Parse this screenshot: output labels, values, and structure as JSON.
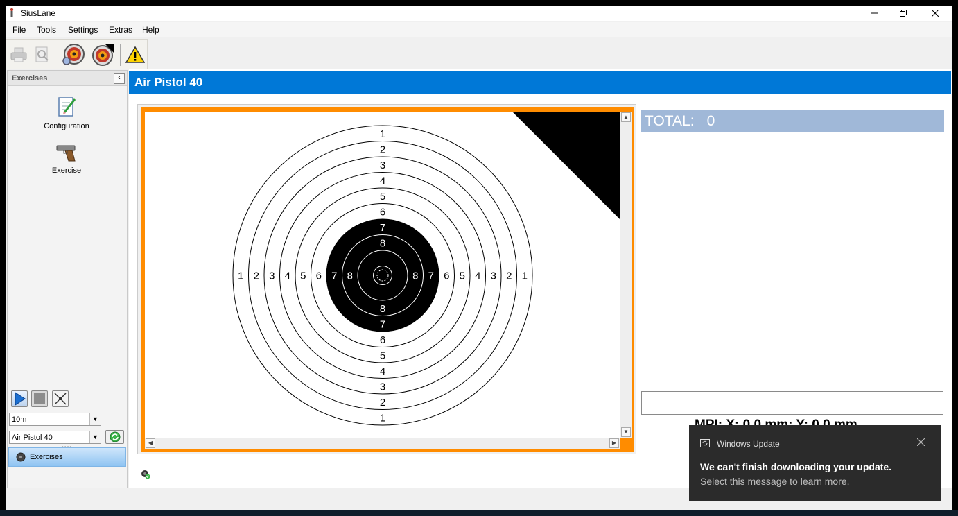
{
  "window": {
    "title": "SiusLane"
  },
  "menu": [
    "File",
    "Tools",
    "Settings",
    "Extras",
    "Help"
  ],
  "toolbar": {
    "buttons": [
      "print-icon",
      "print-preview-icon",
      "target-magnifier-icon",
      "target-corner-icon",
      "warning-icon"
    ]
  },
  "sidebar": {
    "header": "Exercises",
    "items": [
      {
        "label": "Configuration",
        "icon": "notepad-pencil-icon"
      },
      {
        "label": "Exercise",
        "icon": "pistol-icon"
      }
    ],
    "distance": "10m",
    "exercise": "Air Pistol 40",
    "tab": "Exercises"
  },
  "main": {
    "title": "Air Pistol 40",
    "total_label": "TOTAL:",
    "total_value": "0",
    "mpi": "MPI:    X: 0.0 mm; Y: 0.0 mm"
  },
  "target": {
    "ring_numbers": [
      "1",
      "2",
      "3",
      "4",
      "5",
      "6",
      "7",
      "8"
    ],
    "black_from_ring": 7
  },
  "colors": {
    "header_blue": "#0078d7",
    "frame_orange": "#ff8c00",
    "total_bar": "#a0b8d8",
    "toast_bg": "#2b2b2b"
  },
  "toast": {
    "app": "Windows Update",
    "heading": "We can't finish downloading your update.",
    "message": "Select this message to learn more."
  }
}
